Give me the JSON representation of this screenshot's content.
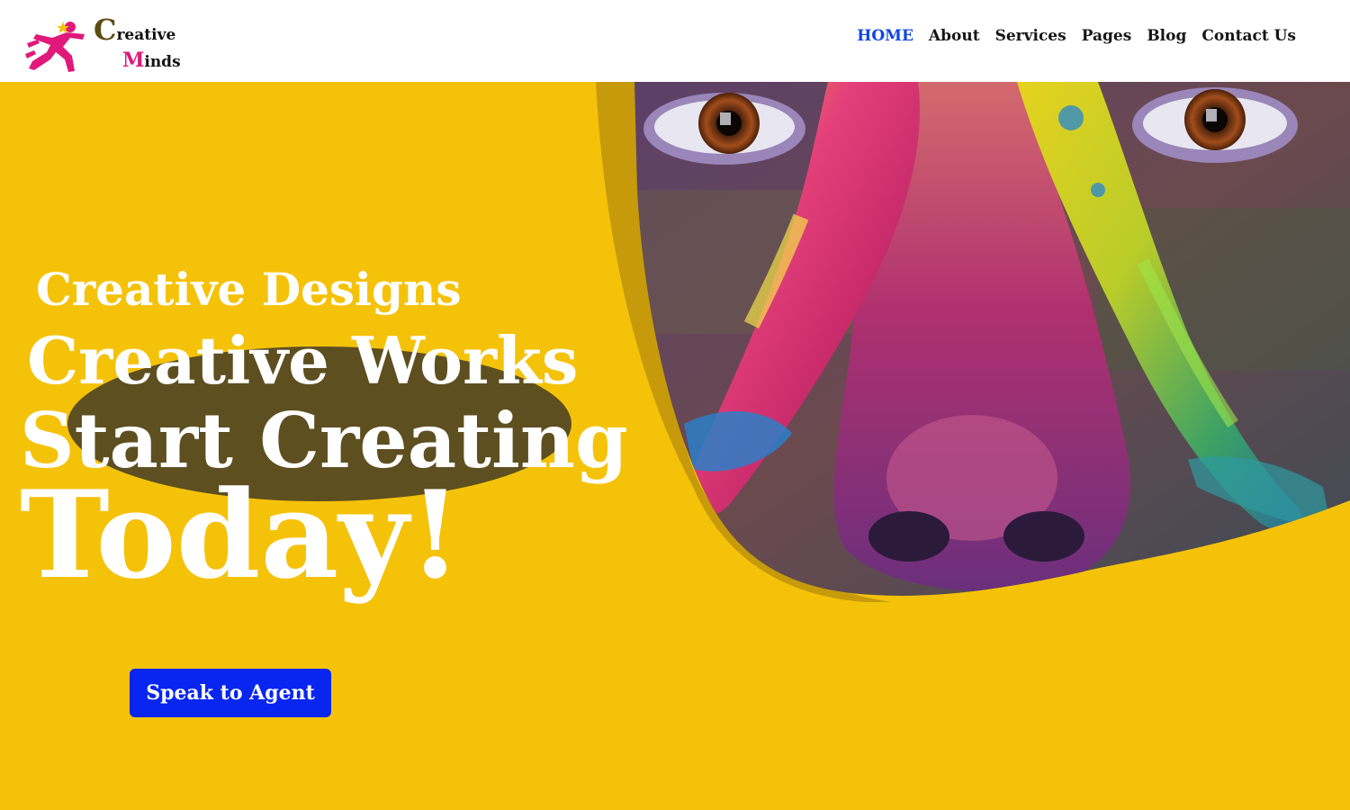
{
  "brand": {
    "cap1": "C",
    "rest1": "reative",
    "cap2": "M",
    "rest2": "inds",
    "icon": "running-person-icon",
    "colors": {
      "accent_pink": "#e0197a",
      "accent_olive": "#5e4d12"
    }
  },
  "nav": {
    "items": [
      {
        "label": "HOME",
        "active": true
      },
      {
        "label": "About"
      },
      {
        "label": "Services"
      },
      {
        "label": "Pages"
      },
      {
        "label": "Blog"
      },
      {
        "label": "Contact Us"
      }
    ],
    "active_color": "#1046e0"
  },
  "hero": {
    "subtitle": "Creative Designs",
    "line1": "Creative Works",
    "line2": "Start Creating",
    "line3": "Today!",
    "image": "painted-face-photo",
    "background_color": "#f5c20a"
  },
  "cta": {
    "label": "Speak to Agent",
    "color": "#0826f0"
  }
}
